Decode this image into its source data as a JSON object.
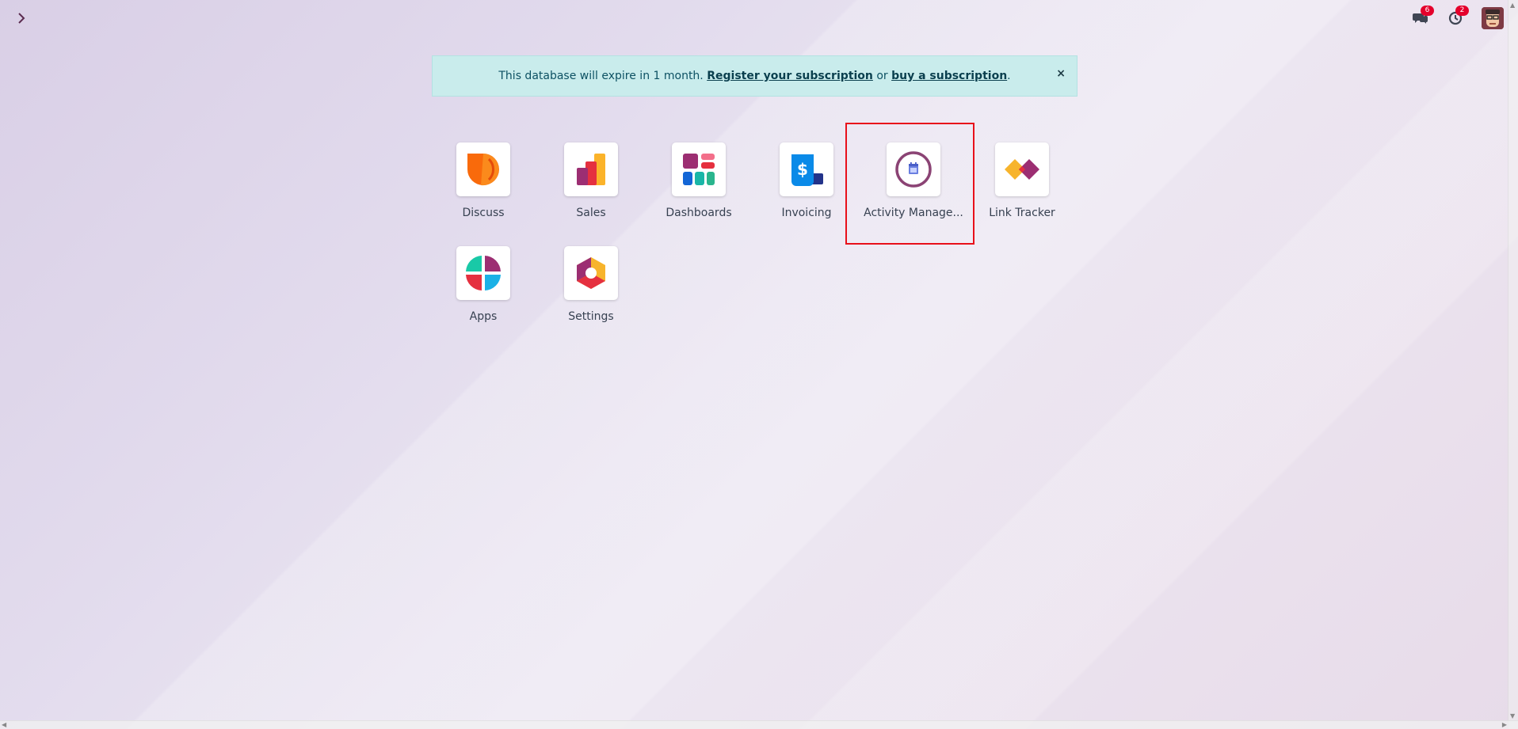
{
  "alert": {
    "message": "This database will expire in 1 month.",
    "register_link": "Register your subscription",
    "separator": "or",
    "buy_link": "buy a subscription",
    "period": ".",
    "close": "×"
  },
  "systray": {
    "messages_badge": "6",
    "activities_badge": "2"
  },
  "apps": [
    {
      "label": "Discuss",
      "icon": "discuss-icon"
    },
    {
      "label": "Sales",
      "icon": "sales-icon"
    },
    {
      "label": "Dashboards",
      "icon": "dashboards-icon"
    },
    {
      "label": "Invoicing",
      "icon": "invoicing-icon"
    },
    {
      "label": "Activity Manage...",
      "icon": "activity-management-icon"
    },
    {
      "label": "Link Tracker",
      "icon": "link-tracker-icon"
    },
    {
      "label": "Apps",
      "icon": "apps-icon"
    },
    {
      "label": "Settings",
      "icon": "settings-icon"
    }
  ],
  "colors": {
    "alert_bg": "#c9ecec",
    "badge": "#e4002b",
    "highlight": "#e8101a"
  }
}
